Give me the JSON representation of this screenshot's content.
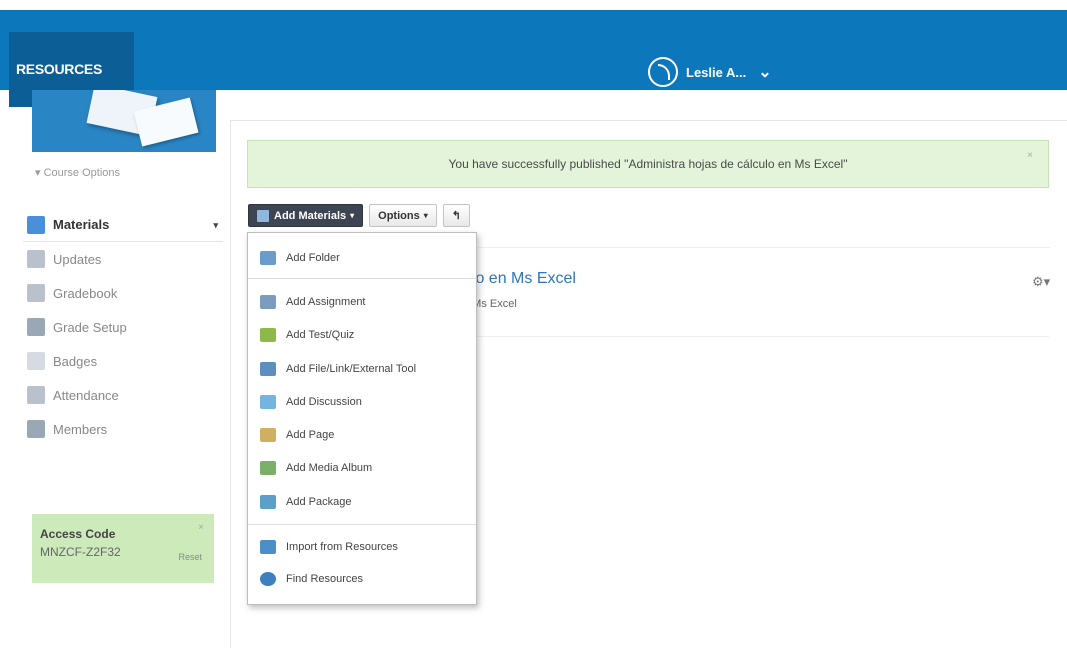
{
  "header": {
    "resources_label": "RESOURCES",
    "user_name": "Leslie A...",
    "user_chevron": "⌄"
  },
  "sidebar": {
    "course_options": "▾  Course Options",
    "items": [
      {
        "label": "Materials",
        "icon": "materials-icon",
        "color": "#4a90d9"
      },
      {
        "label": "Updates",
        "icon": "updates-icon",
        "color": "#b9c2cc"
      },
      {
        "label": "Gradebook",
        "icon": "gradebook-icon",
        "color": "#b9c2cc"
      },
      {
        "label": "Grade Setup",
        "icon": "grade-setup-icon",
        "color": "#9aa8b5"
      },
      {
        "label": "Badges",
        "icon": "badges-icon",
        "color": "#d5dbe0"
      },
      {
        "label": "Attendance",
        "icon": "attendance-icon",
        "color": "#b9c2cc"
      },
      {
        "label": "Members",
        "icon": "members-icon",
        "color": "#9aa8b5"
      }
    ],
    "materials_caret": "▾"
  },
  "access_code": {
    "title": "Access Code",
    "code": "MNZCF-Z2F32",
    "reset": "Reset",
    "close": "×"
  },
  "alert": {
    "message": "You have successfully published \"Administra hojas de cálculo en Ms Excel\"",
    "close": "×"
  },
  "toolbar": {
    "add_materials": "Add Materials",
    "options": "Options",
    "back": "↰",
    "caret": "▾"
  },
  "material_item": {
    "title_visible": "ulo en Ms Excel",
    "subtitle_visible": "n Ms Excel",
    "gear": "⚙▾"
  },
  "dropdown": {
    "items": [
      {
        "label": "Add Folder",
        "icon": "folder-icon",
        "color": "#6a9ccc"
      },
      {
        "label": "Add Assignment",
        "icon": "assignment-icon",
        "color": "#7a9cbf"
      },
      {
        "label": "Add Test/Quiz",
        "icon": "test-quiz-icon",
        "color": "#8fb84a"
      },
      {
        "label": "Add File/Link/External Tool",
        "icon": "file-link-icon",
        "color": "#5a8fbf"
      },
      {
        "label": "Add Discussion",
        "icon": "discussion-icon",
        "color": "#74b4e0"
      },
      {
        "label": "Add Page",
        "icon": "page-icon",
        "color": "#d0b060"
      },
      {
        "label": "Add Media Album",
        "icon": "media-album-icon",
        "color": "#7ab06a"
      },
      {
        "label": "Add Package",
        "icon": "package-icon",
        "color": "#5aa0c8"
      },
      {
        "label": "Import from Resources",
        "icon": "import-icon",
        "color": "#4c8fc7"
      },
      {
        "label": "Find Resources",
        "icon": "find-icon",
        "color": "#3e7fc0"
      }
    ]
  },
  "colors": {
    "brand": "#0d77bb",
    "brand_dark": "#0b5f96",
    "alert_bg": "#e3f4da",
    "access_bg": "#cdeabb"
  }
}
